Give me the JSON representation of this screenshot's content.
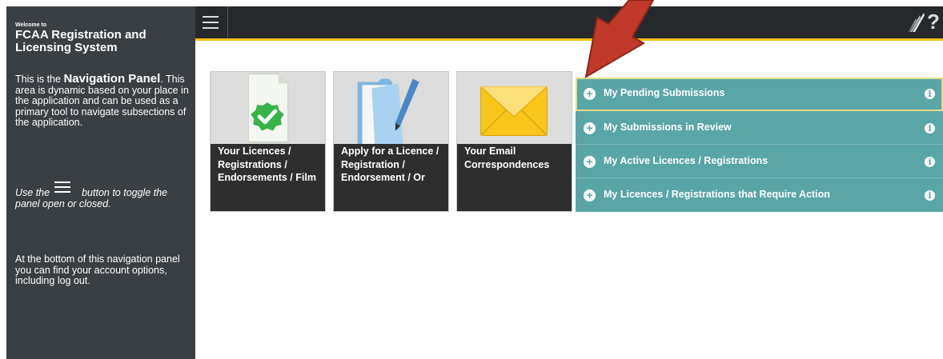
{
  "sidebar": {
    "welcome": "Welcome to",
    "title": "FCAA Registration and Licensing System",
    "intro_prefix": "This is the ",
    "intro_bold": "Navigation Panel",
    "intro_suffix": ". This area is dynamic based on your place in the application and can be used as a primary tool to navigate subsections of the application.",
    "toggle_prefix": "Use the",
    "toggle_suffix": "button to toggle the panel open or closed.",
    "bottom_text": "At the bottom of this navigation panel you can find your account options, including log out."
  },
  "topbar": {
    "help_label": "?",
    "menu_icon": "hamburger-menu-icon",
    "logo_icon": "saskatchewan-logo-icon"
  },
  "tiles": [
    {
      "label": "Your Licences / Registrations / Endorsements / Film",
      "icon": "green-check-document-icon"
    },
    {
      "label": "Apply for a Licence / Registration / Endorsement / Or",
      "icon": "folder-pen-icon"
    },
    {
      "label": "Your Email Correspondences",
      "icon": "envelope-icon"
    }
  ],
  "accordion": [
    {
      "label": "My Pending Submissions"
    },
    {
      "label": "My Submissions in Review"
    },
    {
      "label": "My Active Licences / Registrations"
    },
    {
      "label": "My Licences / Registrations that Require Action"
    }
  ],
  "colors": {
    "sidebar_bg": "#3a3f44",
    "topbar_bg": "#26292c",
    "accent_yellow": "#f5c211",
    "accordion_teal": "#5aa5a6",
    "arrow_red": "#c0392b"
  }
}
